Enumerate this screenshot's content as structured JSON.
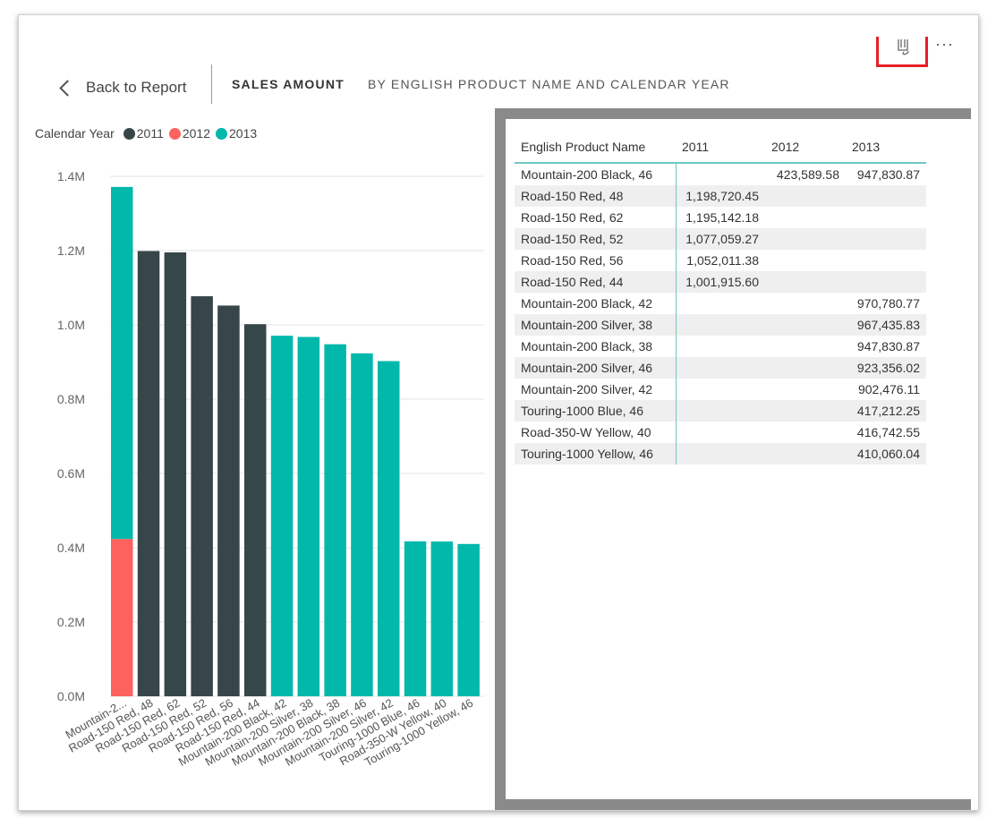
{
  "header": {
    "back_label": "Back to Report",
    "title": "SALES AMOUNT",
    "subtitle": "BY ENGLISH PRODUCT NAME AND CALENDAR YEAR",
    "more_label": "···"
  },
  "legend": {
    "title": "Calendar Year",
    "items": [
      {
        "label": "2011",
        "color": "#374649"
      },
      {
        "label": "2012",
        "color": "#fd625e"
      },
      {
        "label": "2013",
        "color": "#01b8aa"
      }
    ]
  },
  "chart_data": {
    "type": "bar",
    "stacked": true,
    "categories": [
      "Mountain-2...",
      "Road-150 Red, 48",
      "Road-150 Red, 62",
      "Road-150 Red, 52",
      "Road-150 Red, 56",
      "Road-150 Red, 44",
      "Mountain-200 Black, 42",
      "Mountain-200 Silver, 38",
      "Mountain-200 Black, 38",
      "Mountain-200 Silver, 46",
      "Mountain-200 Silver, 42",
      "Touring-1000 Blue, 46",
      "Road-350-W Yellow, 40",
      "Touring-1000 Yellow, 46"
    ],
    "series": [
      {
        "name": "2011",
        "color": "#374649",
        "values": [
          0,
          1198720.45,
          1195142.18,
          1077059.27,
          1052011.38,
          1001915.6,
          0,
          0,
          0,
          0,
          0,
          0,
          0,
          0
        ]
      },
      {
        "name": "2012",
        "color": "#fd625e",
        "values": [
          423589.58,
          0,
          0,
          0,
          0,
          0,
          0,
          0,
          0,
          0,
          0,
          0,
          0,
          0
        ]
      },
      {
        "name": "2013",
        "color": "#01b8aa",
        "values": [
          947830.87,
          0,
          0,
          0,
          0,
          0,
          970780.77,
          967435.83,
          947830.87,
          923356.02,
          902476.11,
          417212.25,
          416742.55,
          410060.04
        ]
      }
    ],
    "yticks": [
      "0.0M",
      "0.2M",
      "0.4M",
      "0.6M",
      "0.8M",
      "1.0M",
      "1.2M",
      "1.4M"
    ],
    "ylim": [
      0,
      1400000
    ],
    "grid": true,
    "legend_position": "top-left"
  },
  "table": {
    "headers": [
      "English Product Name",
      "2011",
      "2012",
      "2013"
    ],
    "rows": [
      [
        "Mountain-200 Black, 46",
        "",
        "423,589.58",
        "947,830.87"
      ],
      [
        "Road-150 Red, 48",
        "1,198,720.45",
        "",
        ""
      ],
      [
        "Road-150 Red, 62",
        "1,195,142.18",
        "",
        ""
      ],
      [
        "Road-150 Red, 52",
        "1,077,059.27",
        "",
        ""
      ],
      [
        "Road-150 Red, 56",
        "1,052,011.38",
        "",
        ""
      ],
      [
        "Road-150 Red, 44",
        "1,001,915.60",
        "",
        ""
      ],
      [
        "Mountain-200 Black, 42",
        "",
        "",
        "970,780.77"
      ],
      [
        "Mountain-200 Silver, 38",
        "",
        "",
        "967,435.83"
      ],
      [
        "Mountain-200 Black, 38",
        "",
        "",
        "947,830.87"
      ],
      [
        "Mountain-200 Silver, 46",
        "",
        "",
        "923,356.02"
      ],
      [
        "Mountain-200 Silver, 42",
        "",
        "",
        "902,476.11"
      ],
      [
        "Touring-1000 Blue, 46",
        "",
        "",
        "417,212.25"
      ],
      [
        "Road-350-W Yellow, 40",
        "",
        "",
        "416,742.55"
      ],
      [
        "Touring-1000 Yellow, 46",
        "",
        "",
        "410,060.04"
      ]
    ]
  }
}
